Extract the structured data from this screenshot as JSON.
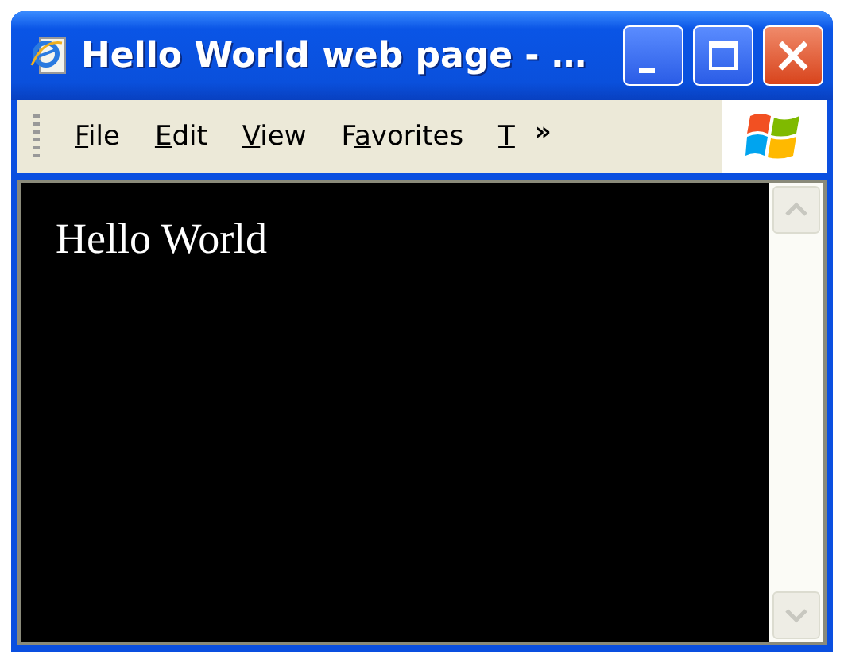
{
  "window": {
    "title": "Hello World web page - …"
  },
  "menu_bar": {
    "items": [
      {
        "key": "F",
        "post": "ile"
      },
      {
        "key": "E",
        "post": "dit"
      },
      {
        "key": "V",
        "post": "iew"
      },
      {
        "pre": "F",
        "key": "a",
        "post": "vorites"
      },
      {
        "key": "T"
      }
    ],
    "overflow": "»"
  },
  "page": {
    "text": "Hello World"
  }
}
